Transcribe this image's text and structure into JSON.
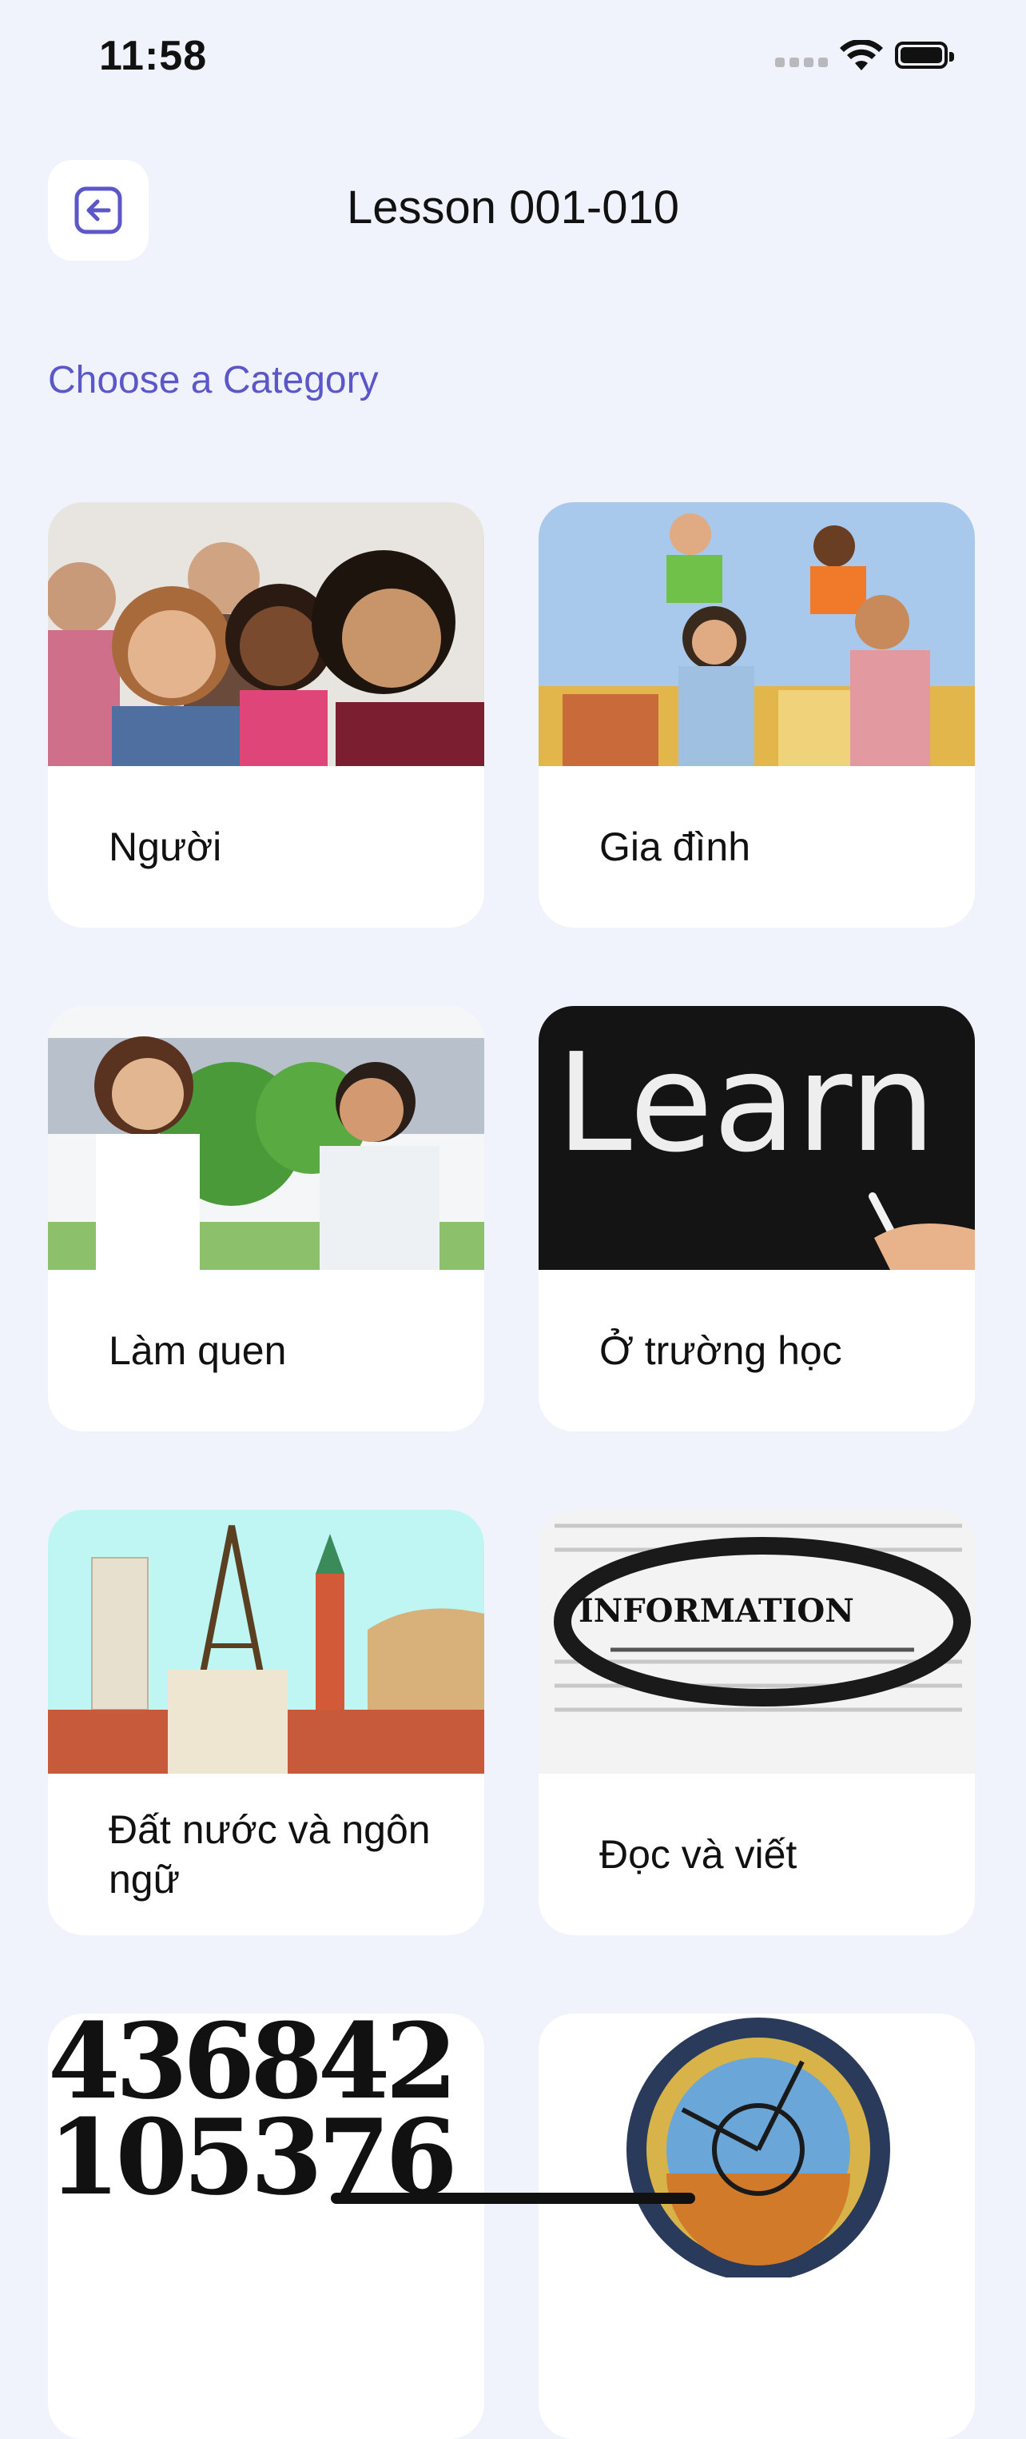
{
  "status_bar": {
    "time": "11:58"
  },
  "header": {
    "title": "Lesson 001-010"
  },
  "section": {
    "label": "Choose a Category"
  },
  "categories": [
    {
      "label": "Người",
      "image": "group-of-people-photo"
    },
    {
      "label": "Gia đình",
      "image": "family-outdoors-photo"
    },
    {
      "label": "Làm quen",
      "image": "two-people-talking-photo"
    },
    {
      "label": "Ở trường học",
      "image": "chalkboard-learn-photo"
    },
    {
      "label": "Đất nước và ngôn ngữ",
      "image": "world-landmarks-photo"
    },
    {
      "label": "Đọc và viết",
      "image": "glasses-on-text-photo"
    },
    {
      "label": "",
      "image": "numbers-photo"
    },
    {
      "label": "",
      "image": "astronomical-clock-photo"
    }
  ],
  "photo_text": {
    "learn": "Learn",
    "information": "INFORMATION",
    "numbers_line1": "436842",
    "numbers_line2": "105376"
  },
  "colors": {
    "accent": "#5b57c8",
    "background": "#f0f3fc",
    "card": "#ffffff"
  }
}
